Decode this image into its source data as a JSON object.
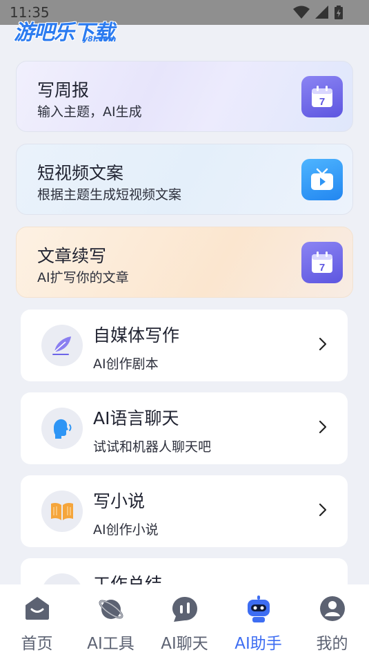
{
  "status_bar": {
    "time": "11:35"
  },
  "watermark": {
    "brand": "游吧乐下载",
    "domain": "y8l.com"
  },
  "feature_cards": [
    {
      "title": "写周报",
      "subtitle": "输入主题，AI生成",
      "icon": "calendar-icon",
      "calendar_day": "7"
    },
    {
      "title": "短视频文案",
      "subtitle": "根据主题生成短视频文案",
      "icon": "tv-play-icon"
    },
    {
      "title": "文章续写",
      "subtitle": "AI扩写你的文章",
      "icon": "calendar-icon",
      "calendar_day": "7"
    }
  ],
  "tools": [
    {
      "title": "自媒体写作",
      "subtitle": "AI创作剧本",
      "icon": "feather-pen-icon"
    },
    {
      "title": "AI语言聊天",
      "subtitle": "试试和机器人聊天吧",
      "icon": "speaking-head-icon"
    },
    {
      "title": "写小说",
      "subtitle": "AI创作小说",
      "icon": "open-book-icon"
    },
    {
      "title": "工作总结",
      "subtitle": "",
      "icon": "pie-chart-icon"
    }
  ],
  "tab_bar": {
    "tabs": [
      {
        "label": "首页",
        "icon": "home-icon"
      },
      {
        "label": "AI工具",
        "icon": "planet-icon"
      },
      {
        "label": "AI聊天",
        "icon": "chat-icon"
      },
      {
        "label": "AI助手",
        "icon": "robot-icon",
        "active": true
      },
      {
        "label": "我的",
        "icon": "user-icon"
      }
    ]
  },
  "colors": {
    "accent": "#3d6df2",
    "icon_purple": "#6b64e8",
    "icon_blue": "#2e95f5",
    "tab_inactive": "#5c6272"
  }
}
